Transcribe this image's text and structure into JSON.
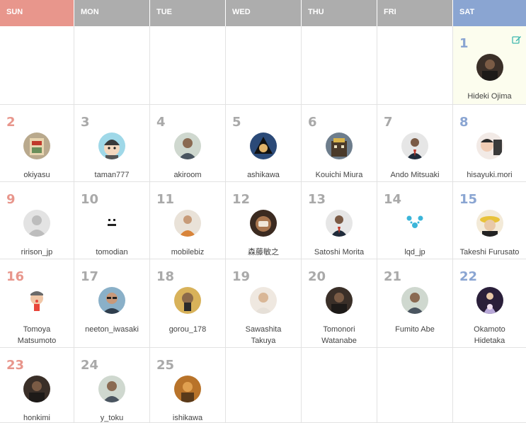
{
  "weekdays": [
    "SUN",
    "MON",
    "TUE",
    "WED",
    "THU",
    "FRI",
    "SAT"
  ],
  "colors": {
    "sun": "#e8968c",
    "weekday": "#adadad",
    "sat": "#8aa5d2",
    "today_bg": "#fcfdee",
    "edit_icon": "#3fb8af"
  },
  "weeks": [
    [
      null,
      null,
      null,
      null,
      null,
      null,
      {
        "day": "1",
        "name": "Hideki Ojima",
        "avatar": "photo-dark-icon",
        "edit": true
      }
    ],
    [
      {
        "day": "2",
        "name": "okiyasu",
        "avatar": "photo-book-icon"
      },
      {
        "day": "3",
        "name": "taman777",
        "avatar": "cartoon-face-icon"
      },
      {
        "day": "4",
        "name": "akiroom",
        "avatar": "photo-person-icon"
      },
      {
        "day": "5",
        "name": "ashikawa",
        "avatar": "photo-anime-icon"
      },
      {
        "day": "6",
        "name": "Kouichi Miura",
        "avatar": "photo-building-icon"
      },
      {
        "day": "7",
        "name": "Ando Mitsuaki",
        "avatar": "photo-suit-icon"
      },
      {
        "day": "8",
        "name": "hisayuki.mori",
        "avatar": "photo-child-icon"
      }
    ],
    [
      {
        "day": "9",
        "name": "ririson_jp",
        "avatar": "default-user-icon"
      },
      {
        "day": "10",
        "name": "tomodian",
        "avatar": "minimal-face-icon"
      },
      {
        "day": "11",
        "name": "mobilebiz",
        "avatar": "photo-speaker-icon"
      },
      {
        "day": "12",
        "name": "森藤敏之",
        "avatar": "photo-food-icon"
      },
      {
        "day": "13",
        "name": "Satoshi Morita",
        "avatar": "photo-suit-icon"
      },
      {
        "day": "14",
        "name": "lqd_jp",
        "avatar": "bear-face-icon"
      },
      {
        "day": "15",
        "name": "Takeshi Furusato",
        "avatar": "photo-hat-icon"
      }
    ],
    [
      {
        "day": "16",
        "name1": "Tomoya",
        "name2": "Matsumoto",
        "avatar": "cartoon-drawing-icon"
      },
      {
        "day": "17",
        "name": "neeton_iwasaki",
        "avatar": "photo-glasses-icon"
      },
      {
        "day": "18",
        "name": "gorou_178",
        "avatar": "photo-selfie-icon"
      },
      {
        "day": "19",
        "name1": "Sawashita",
        "name2": "Takuya",
        "avatar": "photo-light-icon"
      },
      {
        "day": "20",
        "name1": "Tomonori",
        "name2": "Watanabe",
        "avatar": "photo-dark-icon"
      },
      {
        "day": "21",
        "name": "Fumito Abe",
        "avatar": "photo-person-icon"
      },
      {
        "day": "22",
        "name1": "Okamoto",
        "name2": "Hidetaka",
        "avatar": "photo-stage-icon"
      }
    ],
    [
      {
        "day": "23",
        "name": "honkimi",
        "avatar": "photo-dark-icon"
      },
      {
        "day": "24",
        "name": "y_toku",
        "avatar": "photo-person-icon"
      },
      {
        "day": "25",
        "name": "ishikawa",
        "avatar": "photo-warm-icon"
      },
      null,
      null,
      null,
      null
    ]
  ]
}
